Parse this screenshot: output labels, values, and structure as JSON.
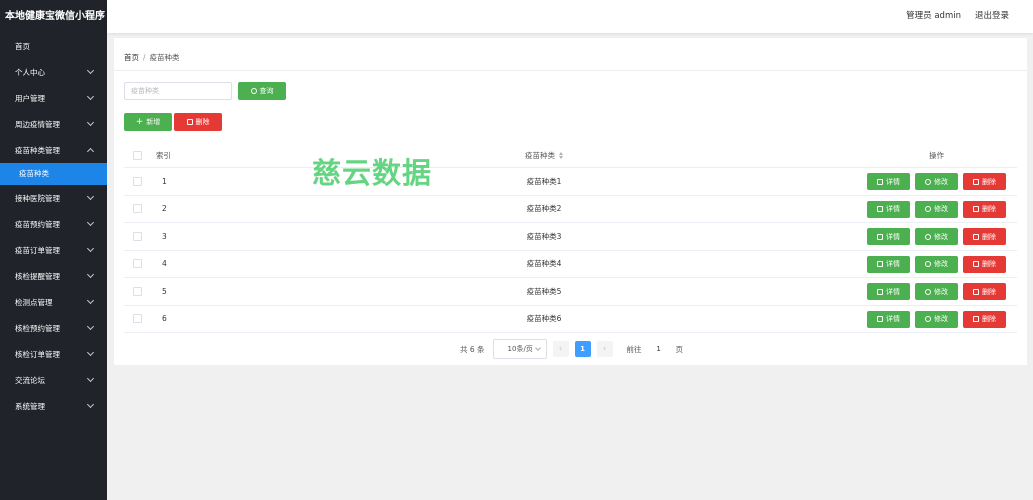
{
  "app_title": "本地健康宝微信小程序",
  "sidebar": {
    "items": [
      {
        "label": "首页",
        "expandable": false
      },
      {
        "label": "个人中心",
        "expandable": true
      },
      {
        "label": "用户管理",
        "expandable": true
      },
      {
        "label": "周边疫情管理",
        "expandable": true
      },
      {
        "label": "疫苗种类管理",
        "expandable": true,
        "open": true
      },
      {
        "label": "接种医院管理",
        "expandable": true
      },
      {
        "label": "疫苗预约管理",
        "expandable": true
      },
      {
        "label": "疫苗订单管理",
        "expandable": true
      },
      {
        "label": "核检提醒管理",
        "expandable": true
      },
      {
        "label": "检测点管理",
        "expandable": true
      },
      {
        "label": "核检预约管理",
        "expandable": true
      },
      {
        "label": "核检订单管理",
        "expandable": true
      },
      {
        "label": "交流论坛",
        "expandable": true
      },
      {
        "label": "系统管理",
        "expandable": true
      }
    ],
    "active_sub": "疫苗种类"
  },
  "header": {
    "user": "管理员 admin",
    "logout": "退出登录"
  },
  "breadcrumb": [
    "首页",
    "疫苗种类"
  ],
  "breadcrumb_sep": "/",
  "search": {
    "placeholder": "疫苗种类",
    "button": "查询"
  },
  "actions": {
    "add": "新增",
    "delete": "删除"
  },
  "table": {
    "headers": {
      "index": "索引",
      "type": "疫苗种类",
      "ops": "操作"
    },
    "rows": [
      {
        "index": "1",
        "type": "疫苗种类1"
      },
      {
        "index": "2",
        "type": "疫苗种类2"
      },
      {
        "index": "3",
        "type": "疫苗种类3"
      },
      {
        "index": "4",
        "type": "疫苗种类4"
      },
      {
        "index": "5",
        "type": "疫苗种类5"
      },
      {
        "index": "6",
        "type": "疫苗种类6"
      }
    ],
    "row_buttons": {
      "detail": "详情",
      "edit": "修改",
      "delete": "删除"
    }
  },
  "pagination": {
    "total": "共 6 条",
    "page_size": "10条/页",
    "current_page": "1",
    "goto_prefix": "前往",
    "goto_value": "1",
    "goto_suffix": "页"
  },
  "watermark": "慈云数据",
  "colors": {
    "sidebar_bg": "#20232a",
    "active_blue": "#1d84e8",
    "green": "#4caf50",
    "red": "#e53935",
    "page_blue": "#409eff"
  }
}
